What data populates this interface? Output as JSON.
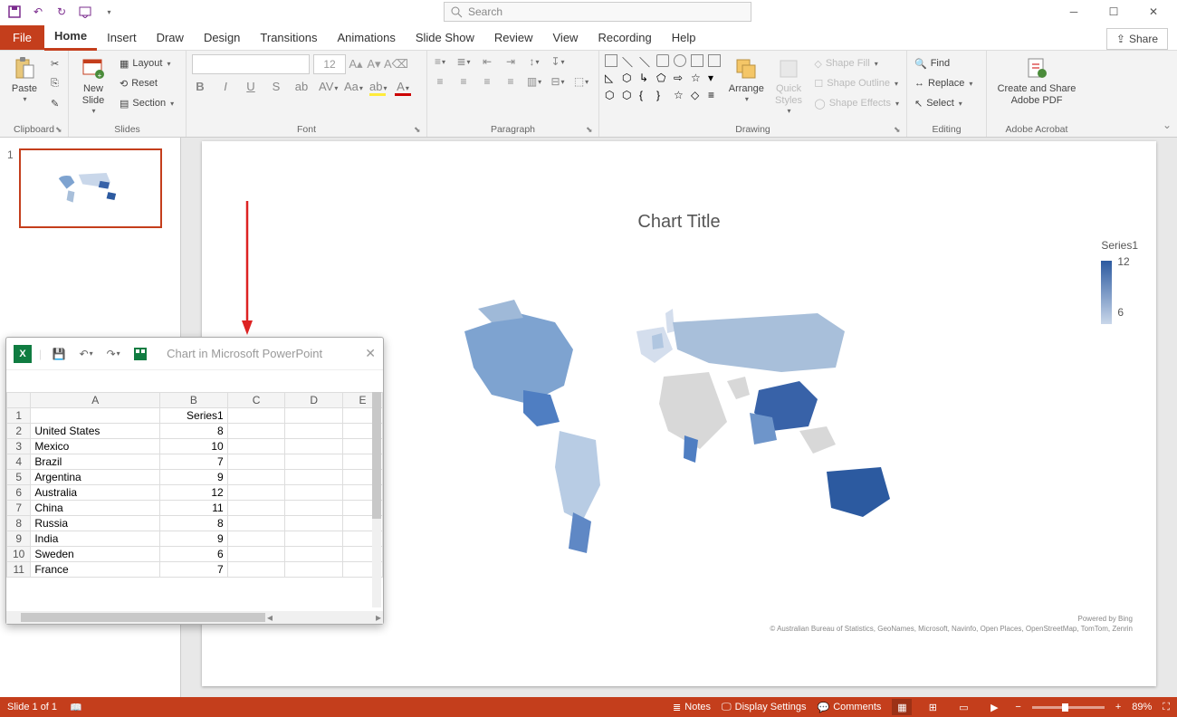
{
  "search": {
    "placeholder": "Search"
  },
  "tabs": {
    "file": "File",
    "home": "Home",
    "insert": "Insert",
    "draw": "Draw",
    "design": "Design",
    "transitions": "Transitions",
    "animations": "Animations",
    "slideshow": "Slide Show",
    "review": "Review",
    "view": "View",
    "recording": "Recording",
    "help": "Help"
  },
  "share": "Share",
  "ribbon": {
    "clipboard": {
      "label": "Clipboard",
      "paste": "Paste"
    },
    "slides": {
      "label": "Slides",
      "newslide": "New\nSlide",
      "layout": "Layout",
      "reset": "Reset",
      "section": "Section"
    },
    "font": {
      "label": "Font",
      "size": "12"
    },
    "paragraph": {
      "label": "Paragraph"
    },
    "drawing": {
      "label": "Drawing",
      "arrange": "Arrange",
      "quick": "Quick\nStyles",
      "fill": "Shape Fill",
      "outline": "Shape Outline",
      "effects": "Shape Effects"
    },
    "editing": {
      "label": "Editing",
      "find": "Find",
      "replace": "Replace",
      "select": "Select"
    },
    "acrobat": {
      "label": "Adobe Acrobat",
      "create": "Create and Share\nAdobe PDF"
    }
  },
  "thumb": {
    "num": "1"
  },
  "chart": {
    "title": "Chart Title",
    "series_label": "Series1",
    "legend_max": "12",
    "legend_min": "6",
    "powered": "Powered by Bing",
    "copyright": "© Australian Bureau of Statistics, GeoNames, Microsoft, Navinfo, Open Places, OpenStreetMap, TomTom, Zenrin"
  },
  "excel": {
    "title": "Chart in Microsoft PowerPoint",
    "cols": [
      "A",
      "B",
      "C",
      "D",
      "E"
    ],
    "header_B": "Series1",
    "rows": [
      {
        "n": "1",
        "a": "",
        "b": ""
      },
      {
        "n": "2",
        "a": "United States",
        "b": "8"
      },
      {
        "n": "3",
        "a": "Mexico",
        "b": "10"
      },
      {
        "n": "4",
        "a": "Brazil",
        "b": "7"
      },
      {
        "n": "5",
        "a": "Argentina",
        "b": "9"
      },
      {
        "n": "6",
        "a": "Australia",
        "b": "12"
      },
      {
        "n": "7",
        "a": "China",
        "b": "11"
      },
      {
        "n": "8",
        "a": "Russia",
        "b": "8"
      },
      {
        "n": "9",
        "a": "India",
        "b": "9"
      },
      {
        "n": "10",
        "a": "Sweden",
        "b": "6"
      },
      {
        "n": "11",
        "a": "France",
        "b": "7"
      }
    ]
  },
  "status": {
    "slide": "Slide 1 of 1",
    "notes": "Notes",
    "display": "Display Settings",
    "comments": "Comments",
    "zoom": "89%"
  },
  "chart_data": {
    "type": "map",
    "title": "Chart Title",
    "series": [
      {
        "name": "Series1",
        "values": [
          {
            "country": "United States",
            "value": 8
          },
          {
            "country": "Mexico",
            "value": 10
          },
          {
            "country": "Brazil",
            "value": 7
          },
          {
            "country": "Argentina",
            "value": 9
          },
          {
            "country": "Australia",
            "value": 12
          },
          {
            "country": "China",
            "value": 11
          },
          {
            "country": "Russia",
            "value": 8
          },
          {
            "country": "India",
            "value": 9
          },
          {
            "country": "Sweden",
            "value": 6
          },
          {
            "country": "France",
            "value": 7
          }
        ]
      }
    ],
    "legend_range": [
      6,
      12
    ]
  }
}
